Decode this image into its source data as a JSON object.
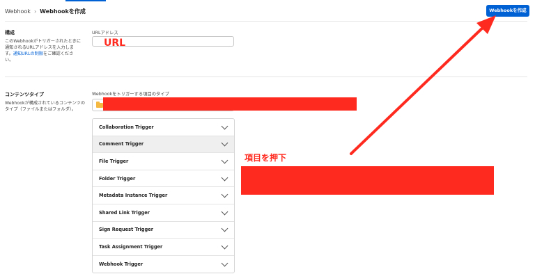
{
  "breadcrumb": {
    "root": "Webhook",
    "separator": "›",
    "current": "Webhookを作成"
  },
  "header": {
    "create_button": "Webhookを作成"
  },
  "config": {
    "title": "構成",
    "desc_before_link": "このWebhookがトリガーされたときに通知されるURLアドレスを入力します。",
    "desc_link": "通知URLの制限",
    "desc_after_link": "をご確認ください。",
    "url_label": "URLアドレス",
    "url_value": ""
  },
  "content_type": {
    "title": "コンテンツタイプ",
    "desc": "Webhookが構成されているコンテンツのタイプ（ファイルまたはフォルダ）。",
    "trigger_type_label": "Webhookをトリガーする項目のタイプ",
    "selected_icon": "folder-icon"
  },
  "triggers": [
    {
      "label": "Collaboration Trigger"
    },
    {
      "label": "Comment Trigger"
    },
    {
      "label": "File Trigger"
    },
    {
      "label": "Folder Trigger"
    },
    {
      "label": "Metadata Instance Trigger"
    },
    {
      "label": "Shared Link Trigger"
    },
    {
      "label": "Sign Request Trigger"
    },
    {
      "label": "Task Assignment Trigger"
    },
    {
      "label": "Webhook Trigger"
    }
  ],
  "annotations": {
    "url_callout": "URL",
    "click_callout": "項目を押下",
    "color": "#ff2a1f"
  },
  "colors": {
    "accent": "#0061d5",
    "annotation_red": "#ff2a1f"
  }
}
